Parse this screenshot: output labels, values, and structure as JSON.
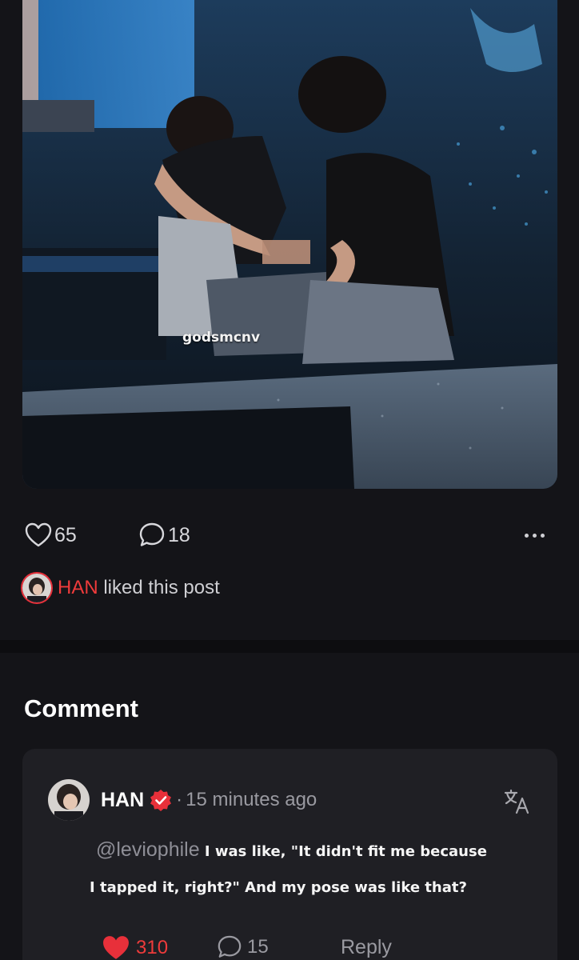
{
  "post": {
    "watermark": "godsmcnv",
    "likes_count": "65",
    "comments_count": "18"
  },
  "liked_by": {
    "name": "HAN",
    "suffix": " liked this post"
  },
  "comments_section": {
    "title": "Comment",
    "items": [
      {
        "author": "HAN",
        "verified": true,
        "separator": "·",
        "time": "15 minutes ago",
        "mention": "@leviophile",
        "text_line1": " I was like, \"It didn't fit me because",
        "text_line2": "I tapped it, right?\" And my pose was like that?",
        "likes": "310",
        "replies": "15",
        "reply_label": "Reply"
      }
    ]
  },
  "colors": {
    "background": "#141418",
    "card": "#1f1f24",
    "accent_red": "#ef3b3b",
    "muted_text": "#9a9aa1"
  },
  "icons": [
    "heart-outline-icon",
    "comment-bubble-icon",
    "more-dots-icon",
    "verified-badge-icon",
    "translate-icon",
    "heart-filled-icon"
  ]
}
